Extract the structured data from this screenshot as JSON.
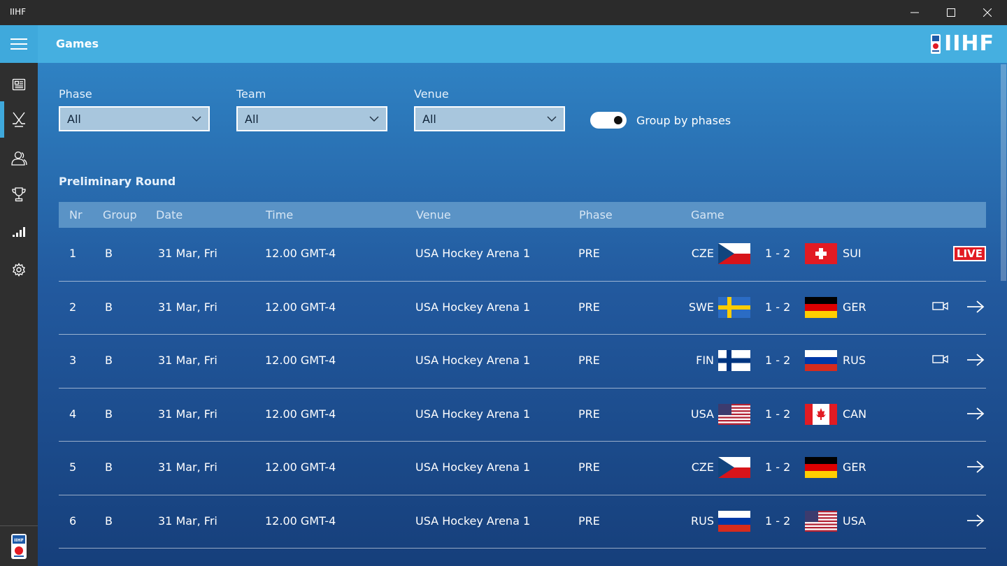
{
  "window": {
    "title": "IIHF"
  },
  "header": {
    "title": "Games",
    "logo_text": "IIHF"
  },
  "filters": {
    "phase": {
      "label": "Phase",
      "value": "All"
    },
    "team": {
      "label": "Team",
      "value": "All"
    },
    "venue": {
      "label": "Venue",
      "value": "All"
    },
    "group_toggle": {
      "label": "Group by phases",
      "on": true
    }
  },
  "section": {
    "title": "Preliminary Round"
  },
  "table": {
    "headers": {
      "nr": "Nr",
      "group": "Group",
      "date": "Date",
      "time": "Time",
      "venue": "Venue",
      "phase": "Phase",
      "game": "Game"
    },
    "rows": [
      {
        "nr": "1",
        "group": "B",
        "date": "31 Mar, Fri",
        "time": "12.00 GMT-4",
        "venue": "USA Hockey Arena 1",
        "phase": "PRE",
        "home": "CZE",
        "score": "1 - 2",
        "away": "SUI",
        "live": "LIVE",
        "video": false
      },
      {
        "nr": "2",
        "group": "B",
        "date": "31 Mar, Fri",
        "time": "12.00 GMT-4",
        "venue": "USA Hockey Arena 1",
        "phase": "PRE",
        "home": "SWE",
        "score": "1 - 2",
        "away": "GER",
        "live": "",
        "video": true
      },
      {
        "nr": "3",
        "group": "B",
        "date": "31 Mar, Fri",
        "time": "12.00 GMT-4",
        "venue": "USA Hockey Arena 1",
        "phase": "PRE",
        "home": "FIN",
        "score": "1 - 2",
        "away": "RUS",
        "live": "",
        "video": true
      },
      {
        "nr": "4",
        "group": "B",
        "date": "31 Mar, Fri",
        "time": "12.00 GMT-4",
        "venue": "USA Hockey Arena 1",
        "phase": "PRE",
        "home": "USA",
        "score": "1 - 2",
        "away": "CAN",
        "live": "",
        "video": false
      },
      {
        "nr": "5",
        "group": "B",
        "date": "31 Mar, Fri",
        "time": "12.00 GMT-4",
        "venue": "USA Hockey Arena 1",
        "phase": "PRE",
        "home": "CZE",
        "score": "1 - 2",
        "away": "GER",
        "live": "",
        "video": false
      },
      {
        "nr": "6",
        "group": "B",
        "date": "31 Mar, Fri",
        "time": "12.00 GMT-4",
        "venue": "USA Hockey Arena 1",
        "phase": "PRE",
        "home": "RUS",
        "score": "1 - 2",
        "away": "USA",
        "live": "",
        "video": false
      }
    ]
  },
  "sidebar": {
    "items": [
      {
        "icon": "news-icon"
      },
      {
        "icon": "hockey-sticks-icon",
        "active": true
      },
      {
        "icon": "players-icon"
      },
      {
        "icon": "trophy-icon"
      },
      {
        "icon": "stats-icon"
      },
      {
        "icon": "settings-icon"
      }
    ]
  },
  "colors": {
    "accent": "#45afe0",
    "live": "#e21b23",
    "sidebar": "#2f2f2f",
    "titlebar": "#2b2b2b"
  }
}
